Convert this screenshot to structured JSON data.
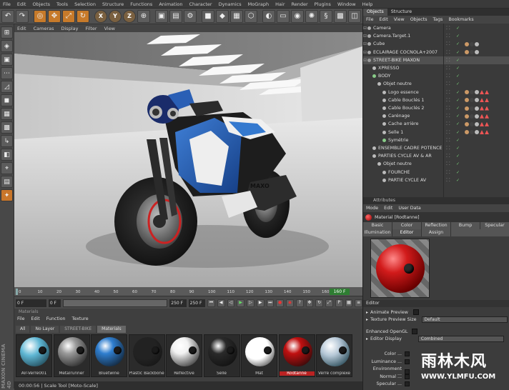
{
  "menubar": [
    "File",
    "Edit",
    "Objects",
    "Tools",
    "Selection",
    "Structure",
    "Functions",
    "Animation",
    "Character",
    "Dynamics",
    "MoGraph",
    "Hair",
    "Render",
    "Plugins",
    "Window",
    "Help"
  ],
  "viewport_menu": [
    "Edit",
    "Cameras",
    "Display",
    "Filter",
    "View"
  ],
  "toolbar_icons": [
    "undo-icon",
    "redo-icon",
    "live-select-icon",
    "move-icon",
    "scale-icon",
    "rotate-icon",
    "x-axis-icon",
    "y-axis-icon",
    "z-axis-icon",
    "world-coords-icon",
    "render-view-icon",
    "render-picture-queue-icon",
    "render-settings-icon",
    "cube-icon",
    "subdivision-icon",
    "array-icon",
    "extrude-icon",
    "deformer-icon",
    "floor-icon",
    "camera-icon",
    "light-icon",
    "python-icon",
    "texture-icon",
    "scene-icon"
  ],
  "object_manager": {
    "tabs": [
      "Objects",
      "Structure"
    ],
    "menu": [
      "File",
      "Edit",
      "View",
      "Objects",
      "Tags",
      "Bookmarks"
    ],
    "items": [
      {
        "name": "Camera",
        "level": 0,
        "color": "#aaaaaa"
      },
      {
        "name": "Camera.Target.1",
        "level": 0,
        "color": "#aaaaaa"
      },
      {
        "name": "Cube",
        "level": 0,
        "color": "#aaaaaa"
      },
      {
        "name": "ÉCLAIRAGE COCNOLA+2007",
        "level": 0,
        "color": "#aaaaaa"
      },
      {
        "name": "STREET-BIKE MAXON",
        "level": 0,
        "color": "#9a9a9a"
      },
      {
        "name": "XPRESSO",
        "level": 1,
        "color": "#bbbbbb"
      },
      {
        "name": "BODY",
        "level": 1,
        "color": "#88cc88"
      },
      {
        "name": "Objet neutre",
        "level": 2,
        "color": "#bbbbbb"
      },
      {
        "name": "Logo essence",
        "level": 3,
        "color": "#bbbbbb"
      },
      {
        "name": "Cable Bouclés 1",
        "level": 3,
        "color": "#bbbbbb"
      },
      {
        "name": "Cable Bouclés 2",
        "level": 3,
        "color": "#bbbbbb"
      },
      {
        "name": "Carénage",
        "level": 3,
        "color": "#bbbbbb"
      },
      {
        "name": "Cache arrière",
        "level": 3,
        "color": "#bbbbbb"
      },
      {
        "name": "Selle 1",
        "level": 3,
        "color": "#bbbbbb"
      },
      {
        "name": "Symétrie",
        "level": 3,
        "color": "#88cc88"
      },
      {
        "name": "ENSEMBLE CADRE POTENCE",
        "level": 1,
        "color": "#bbbbbb"
      },
      {
        "name": "PARTIES CYCLE AV & AR",
        "level": 1,
        "color": "#bbbbbb"
      },
      {
        "name": "Objet neutre",
        "level": 2,
        "color": "#bbbbbb"
      },
      {
        "name": "FOURCHE",
        "level": 3,
        "color": "#bbbbbb"
      },
      {
        "name": "PARTIE CYCLE AV",
        "level": 3,
        "color": "#bbbbbb"
      }
    ]
  },
  "attributes": {
    "title": "Attributes",
    "menu": [
      "Mode",
      "Edit",
      "User Data"
    ],
    "material_name": "Material [Rodtanne]",
    "tabs_row1": [
      "Basic",
      "Color",
      "Reflection",
      "Bump",
      "Specular"
    ],
    "tabs_row2": [
      "Illumination",
      "Editor",
      "Assign"
    ],
    "section_editor": "Editor",
    "animate_preview": "Animate Preview",
    "texture_preview_size_label": "Texture Preview Size",
    "texture_preview_size_value": "Default",
    "enhanced_opengl": "Enhanced OpenGL",
    "enhanced_opengl_value": "Combined",
    "editor_display_label": "Editor Display",
    "channels": [
      "Color",
      "Luminance",
      "Environment",
      "Normal",
      "Specular"
    ]
  },
  "timeline": {
    "ticks": [
      "0",
      "10",
      "20",
      "30",
      "40",
      "50",
      "60",
      "70",
      "80",
      "90",
      "100",
      "110",
      "120",
      "130",
      "140",
      "150",
      "160"
    ],
    "frame_end": "160 F",
    "current_start": "0 F",
    "field1": "0 F",
    "field2": "250 F",
    "field3": "250 F"
  },
  "materials": {
    "menu": [
      "File",
      "Edit",
      "Function",
      "Texture"
    ],
    "title": "Materials",
    "filters": [
      "All",
      "No Layer",
      "STREET-BIKE",
      "Materials"
    ],
    "swatches": [
      {
        "name": "Air-Verre001",
        "color": "#5fb7d4",
        "type": "glass"
      },
      {
        "name": "Metalrunner",
        "color": "#9a9a9a",
        "type": "metal"
      },
      {
        "name": "Bluetwine",
        "color": "#2f7ecf",
        "type": "shiny"
      },
      {
        "name": "Plastic Backbone",
        "color": "#222222",
        "type": "matte"
      },
      {
        "name": "Reflective",
        "color": "#f2f2f2",
        "type": "shiny"
      },
      {
        "name": "Selle",
        "color": "#2a2a2a",
        "type": "shiny"
      },
      {
        "name": "Mat",
        "color": "#ffffff",
        "type": "matte"
      },
      {
        "name": "Rodtanne",
        "color": "#c01010",
        "type": "shiny"
      },
      {
        "name": "Verre complexe",
        "color": "#b5c7d6",
        "type": "glass"
      }
    ]
  },
  "status": "00:00:56  |  Scale Tool [Moto-Scale]",
  "watermark": {
    "line1": "雨林木风",
    "line2": "WWW.YLMFU.COM"
  },
  "side_text": "MAXON CINEMA 4D"
}
